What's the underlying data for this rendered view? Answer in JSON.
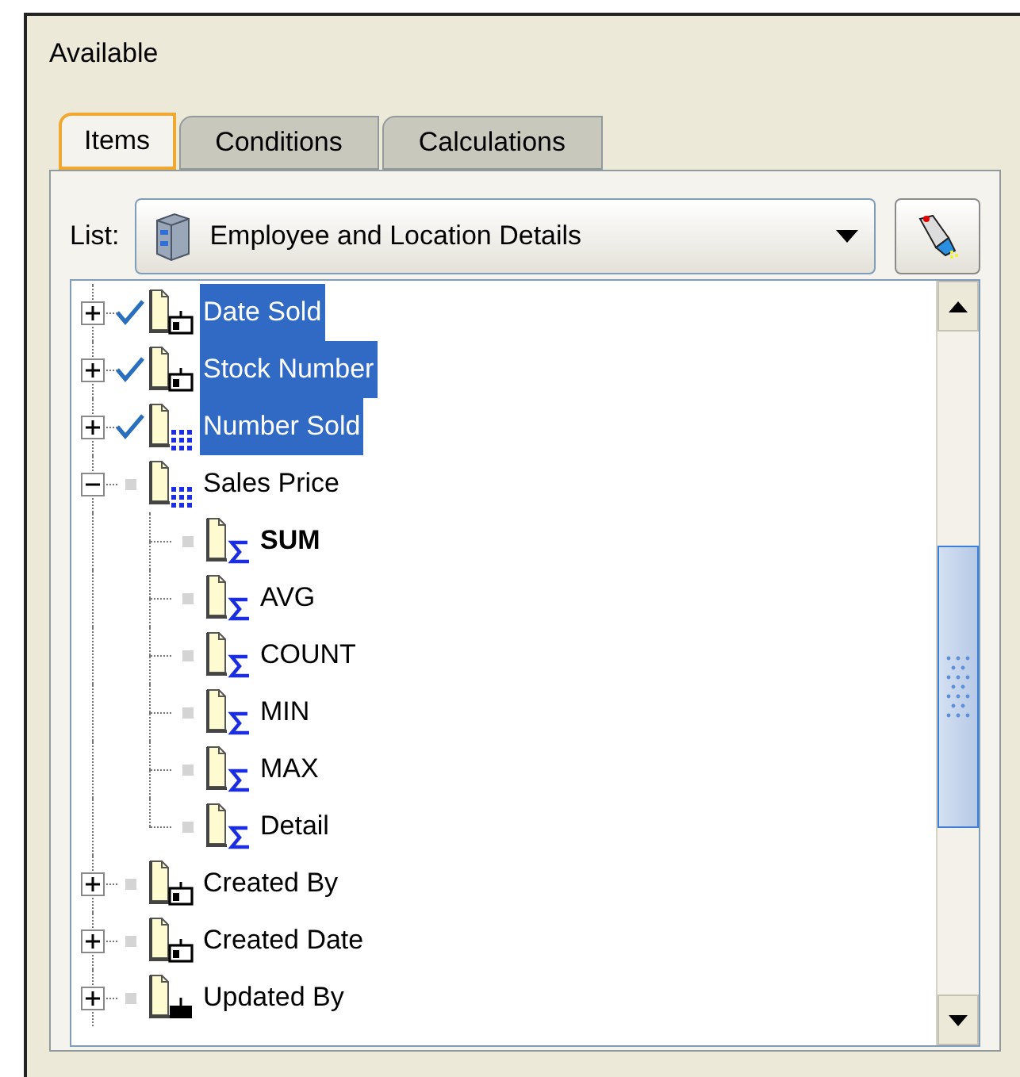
{
  "section_label": "Available",
  "tabs": [
    {
      "label": "Items",
      "selected": true
    },
    {
      "label": "Conditions",
      "selected": false
    },
    {
      "label": "Calculations",
      "selected": false
    }
  ],
  "list": {
    "label": "List:",
    "value": "Employee and Location Details"
  },
  "tree": [
    {
      "label": "Date Sold",
      "kind": "date",
      "checked": true,
      "selected": true,
      "expanded": false
    },
    {
      "label": "Stock Number",
      "kind": "date",
      "checked": true,
      "selected": true,
      "expanded": false
    },
    {
      "label": "Number Sold",
      "kind": "number",
      "checked": true,
      "selected": true,
      "expanded": false
    },
    {
      "label": "Sales Price",
      "kind": "number",
      "checked": false,
      "selected": false,
      "expanded": true,
      "children": [
        {
          "label": "SUM",
          "kind": "sigma",
          "checked": false,
          "selected": false,
          "default": true
        },
        {
          "label": "AVG",
          "kind": "sigma",
          "checked": false,
          "selected": false,
          "default": false
        },
        {
          "label": "COUNT",
          "kind": "sigma",
          "checked": false,
          "selected": false,
          "default": false
        },
        {
          "label": "MIN",
          "kind": "sigma",
          "checked": false,
          "selected": false,
          "default": false
        },
        {
          "label": "MAX",
          "kind": "sigma",
          "checked": false,
          "selected": false,
          "default": false
        },
        {
          "label": "Detail",
          "kind": "sigma",
          "checked": false,
          "selected": false,
          "default": false
        }
      ]
    },
    {
      "label": "Created By",
      "kind": "date",
      "checked": false,
      "selected": false,
      "expanded": false
    },
    {
      "label": "Created Date",
      "kind": "date",
      "checked": false,
      "selected": false,
      "expanded": false
    },
    {
      "label": "Updated By",
      "kind": "text",
      "checked": false,
      "selected": false,
      "expanded": false
    }
  ]
}
